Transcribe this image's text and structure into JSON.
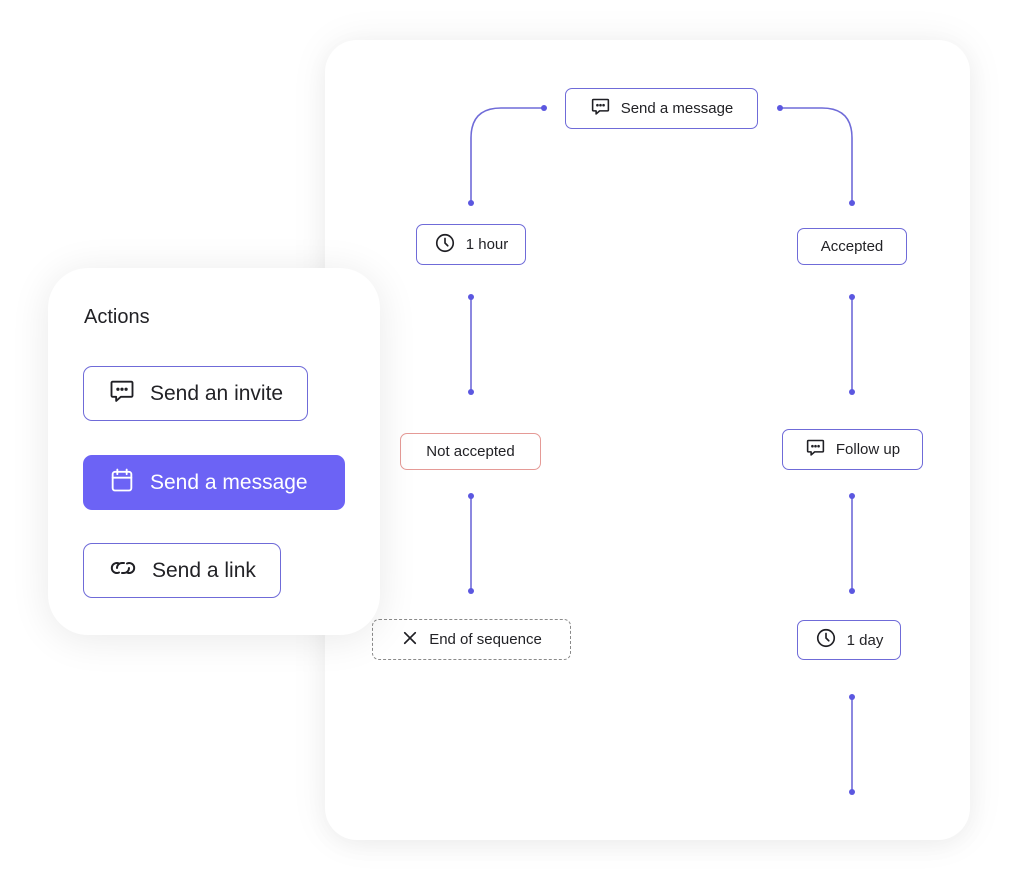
{
  "colors": {
    "accent": "#6c63f5",
    "connector": "#6f6bd8",
    "node_border": "#6f6bd8",
    "negative_border": "#e59a96",
    "end_border": "#8a8a8a"
  },
  "flow": {
    "root": {
      "label": "Send a message",
      "icon": "chat-bubble-icon"
    },
    "left_branch": [
      {
        "label": "1 hour",
        "icon": "clock-icon",
        "style": "default"
      },
      {
        "label": "Not accepted",
        "icon": null,
        "style": "negative"
      },
      {
        "label": "End of sequence",
        "icon": "close-icon",
        "style": "dashed"
      }
    ],
    "right_branch": [
      {
        "label": "Accepted",
        "icon": null,
        "style": "default"
      },
      {
        "label": "Follow up",
        "icon": "chat-bubble-icon",
        "style": "default"
      },
      {
        "label": "1 day",
        "icon": "clock-icon",
        "style": "default"
      }
    ]
  },
  "actions": {
    "title": "Actions",
    "items": [
      {
        "label": "Send an invite",
        "icon": "chat-bubble-icon",
        "active": false
      },
      {
        "label": "Send a message",
        "icon": "calendar-icon",
        "active": true
      },
      {
        "label": "Send a link",
        "icon": "link-icon",
        "active": false
      }
    ]
  }
}
